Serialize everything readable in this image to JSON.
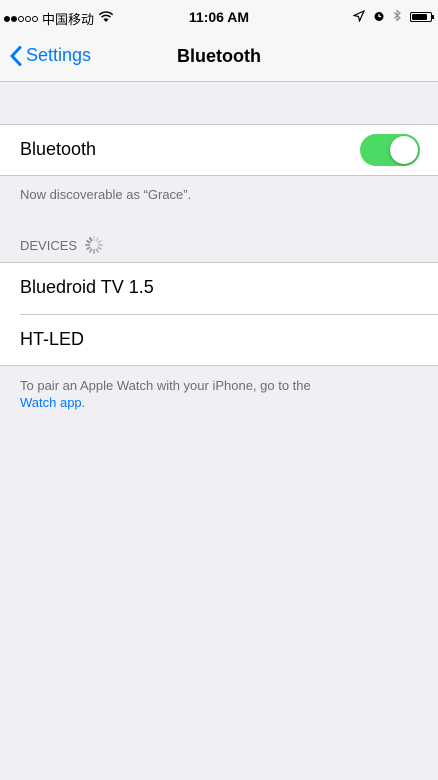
{
  "status_bar": {
    "carrier": "中国移动",
    "time": "11:06 AM",
    "signal_bars_filled": 2,
    "signal_bars_total": 5,
    "battery_level": 0.85
  },
  "nav": {
    "back_label": "Settings",
    "title": "Bluetooth"
  },
  "bluetooth": {
    "label": "Bluetooth",
    "enabled": true,
    "discoverable_text": "Now discoverable as “Grace”."
  },
  "devices": {
    "header": "DEVICES",
    "items": [
      {
        "name": "Bluedroid TV 1.5"
      },
      {
        "name": "HT-LED"
      }
    ]
  },
  "footer": {
    "text": "To pair an Apple Watch with your iPhone, go to the",
    "link": "Watch app",
    "end": "."
  },
  "colors": {
    "accent": "#007aff",
    "toggle_on": "#4cd964",
    "background": "#efeff4"
  },
  "icons": [
    "wifi-icon",
    "location-arrow-icon",
    "alarm-clock-icon",
    "bluetooth-icon",
    "battery-icon",
    "chevron-left-icon",
    "activity-spinner-icon"
  ]
}
